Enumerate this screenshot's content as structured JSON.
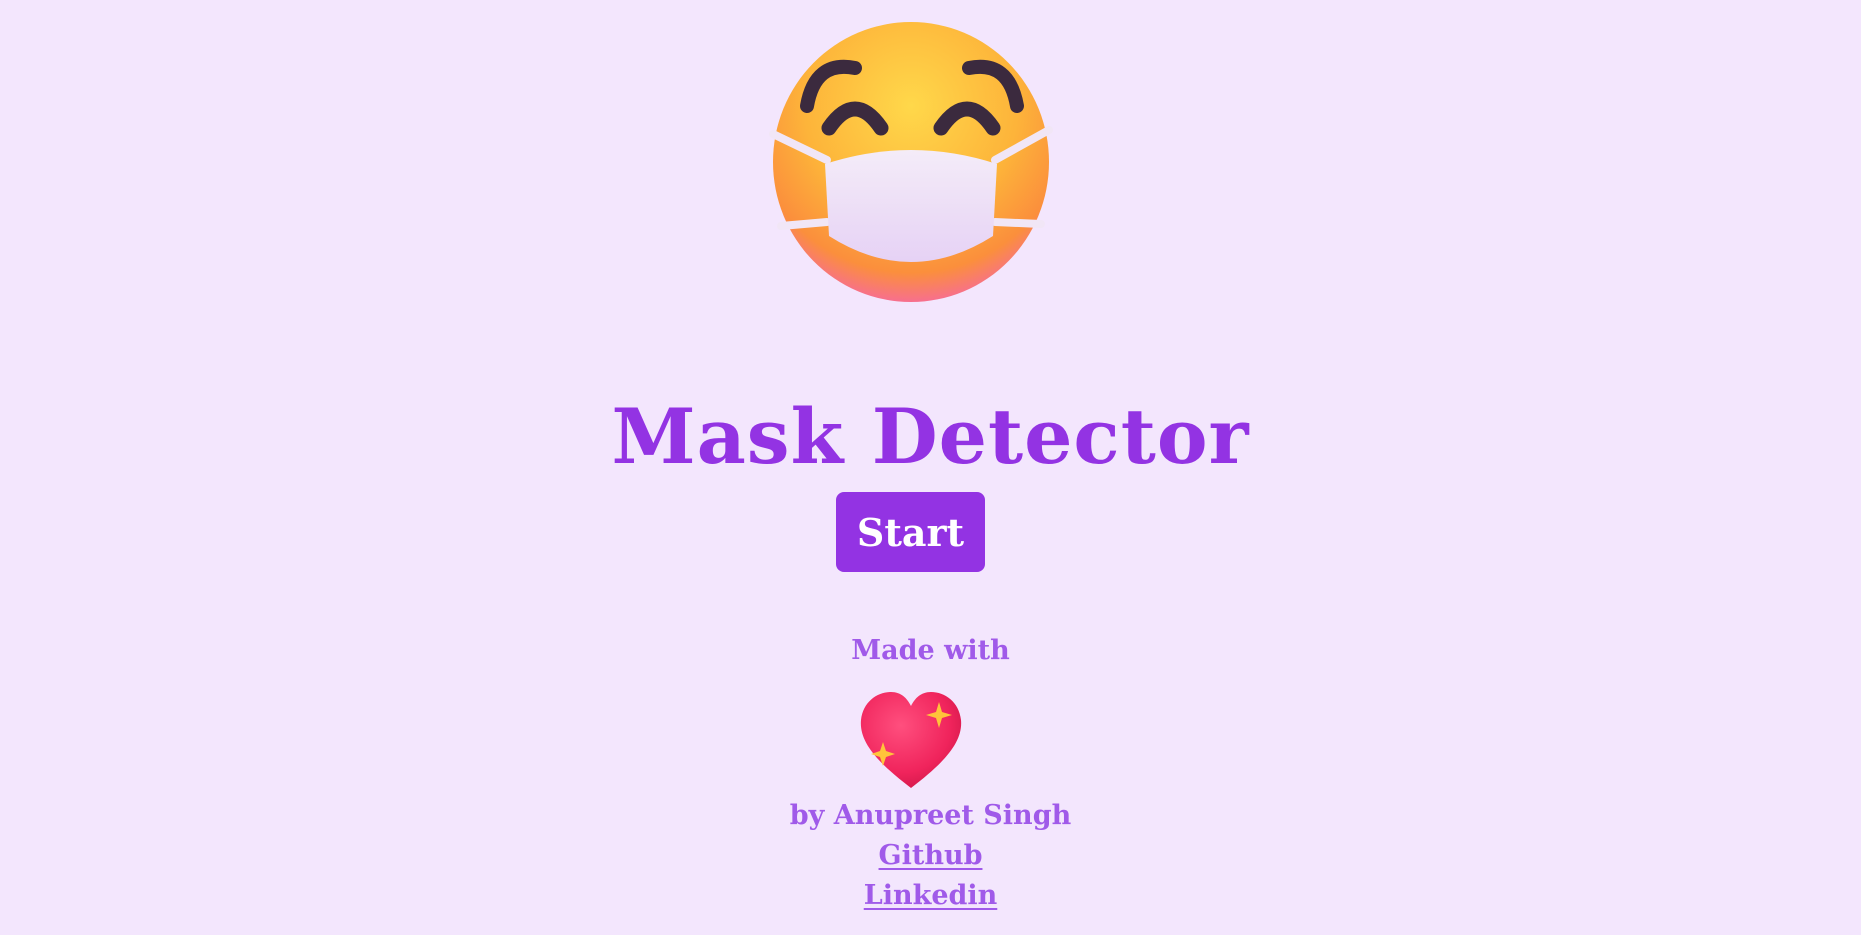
{
  "page": {
    "title": "Mask Detector",
    "start_label": "Start"
  },
  "footer": {
    "made_with": "Made with",
    "heart_icon": "sparkling-heart-icon",
    "byline": "by Anupreet Singh",
    "github_label": "Github",
    "linkedin_label": "Linkedin"
  },
  "icons": {
    "hero": "face-with-medical-mask-icon"
  },
  "colors": {
    "background": "#f3e6fd",
    "accent": "#9333e3",
    "muted_accent": "#a05ae9",
    "button_text": "#ffffff"
  }
}
